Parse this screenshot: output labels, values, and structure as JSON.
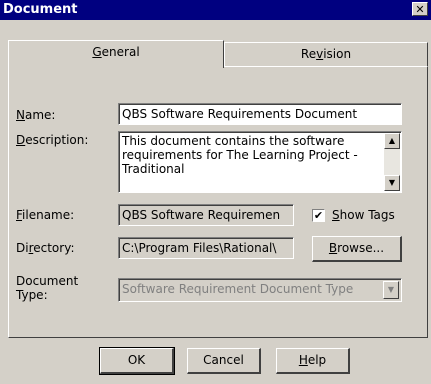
{
  "window": {
    "title": "Document",
    "close_glyph": "✕"
  },
  "tabs": [
    {
      "label_pre": "",
      "label_u": "G",
      "label_post": "eneral",
      "active": true
    },
    {
      "label_pre": "Re",
      "label_u": "v",
      "label_post": "ision",
      "active": false
    }
  ],
  "fields": {
    "name": {
      "label_u": "N",
      "label_post": "ame:",
      "value": "QBS Software Requirements Document"
    },
    "description": {
      "label_u": "D",
      "label_post": "escription:",
      "value": "This document contains the software requirements for The Learning Project - Traditional"
    },
    "filename": {
      "label_u": "F",
      "label_post": "ilename:",
      "value": "QBS Software Requiremen"
    },
    "directory": {
      "label_pre": "Di",
      "label_u": "r",
      "label_post": "ectory:",
      "value": "C:\\Program Files\\Rational\\"
    },
    "doctype": {
      "label_line1": "Document",
      "label_line2": "Type:",
      "value": "Software Requirement Document Type"
    }
  },
  "show_tags": {
    "label_u": "S",
    "label_post": "how Tags",
    "checked_glyph": "✔"
  },
  "buttons": {
    "browse": {
      "label_u": "B",
      "label_post": "rowse..."
    },
    "ok": "OK",
    "cancel": "Cancel",
    "help": {
      "label_u": "H",
      "label_post": "elp"
    }
  },
  "icons": {
    "scroll_up": "▲",
    "scroll_down": "▼",
    "combo_down": "▼"
  }
}
